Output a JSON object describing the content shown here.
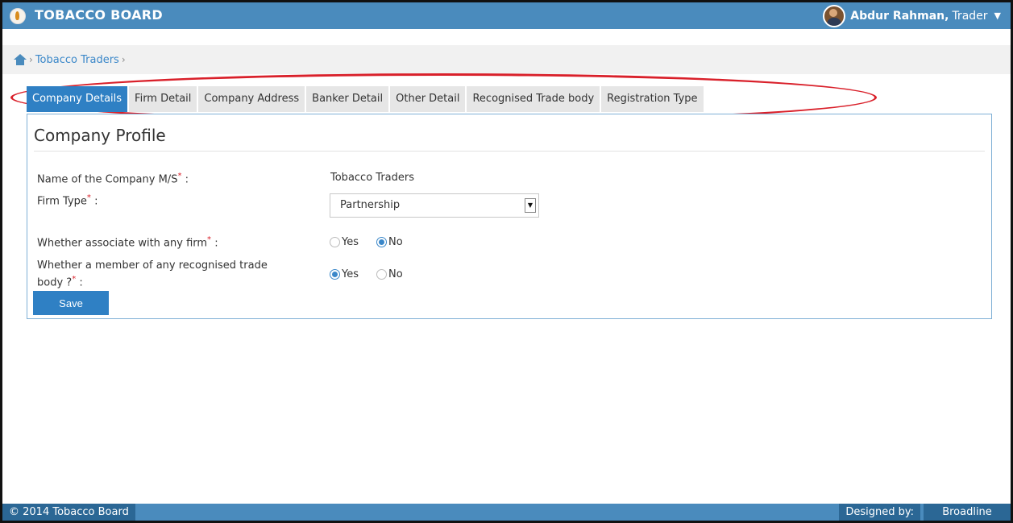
{
  "header": {
    "brand": "TOBACCO BOARD",
    "user_name": "Abdur Rahman,",
    "user_role": "Trader"
  },
  "breadcrumb": {
    "current": "Tobacco Traders"
  },
  "tabs": [
    {
      "label": "Company Details",
      "active": true
    },
    {
      "label": "Firm Detail",
      "active": false
    },
    {
      "label": "Company Address",
      "active": false
    },
    {
      "label": "Banker Detail",
      "active": false
    },
    {
      "label": "Other Detail",
      "active": false
    },
    {
      "label": "Recognised Trade body",
      "active": false
    },
    {
      "label": "Registration Type",
      "active": false
    }
  ],
  "form": {
    "title": "Company Profile",
    "company_name_label": "Name of the Company M/S",
    "company_name_value": "Tobacco Traders",
    "firm_type_label": "Firm Type",
    "firm_type_value": "Partnership",
    "associate_label": "Whether associate with any firm",
    "associate_yes": "Yes",
    "associate_no": "No",
    "associate_selected": "No",
    "member_label_line1": "Whether a member of any recognised trade",
    "member_label_line2": "body ?",
    "member_yes": "Yes",
    "member_no": "No",
    "member_selected": "Yes",
    "required_mark": "*",
    "colon": ":",
    "save_label": "Save"
  },
  "footer": {
    "copyright": "© 2014 Tobacco Board",
    "designed_by": "Designed by:",
    "company": "Broadline"
  },
  "colors": {
    "header_blue": "#4a8bbd",
    "active_tab": "#2f80c4",
    "highlight_ellipse": "#d9202a"
  }
}
